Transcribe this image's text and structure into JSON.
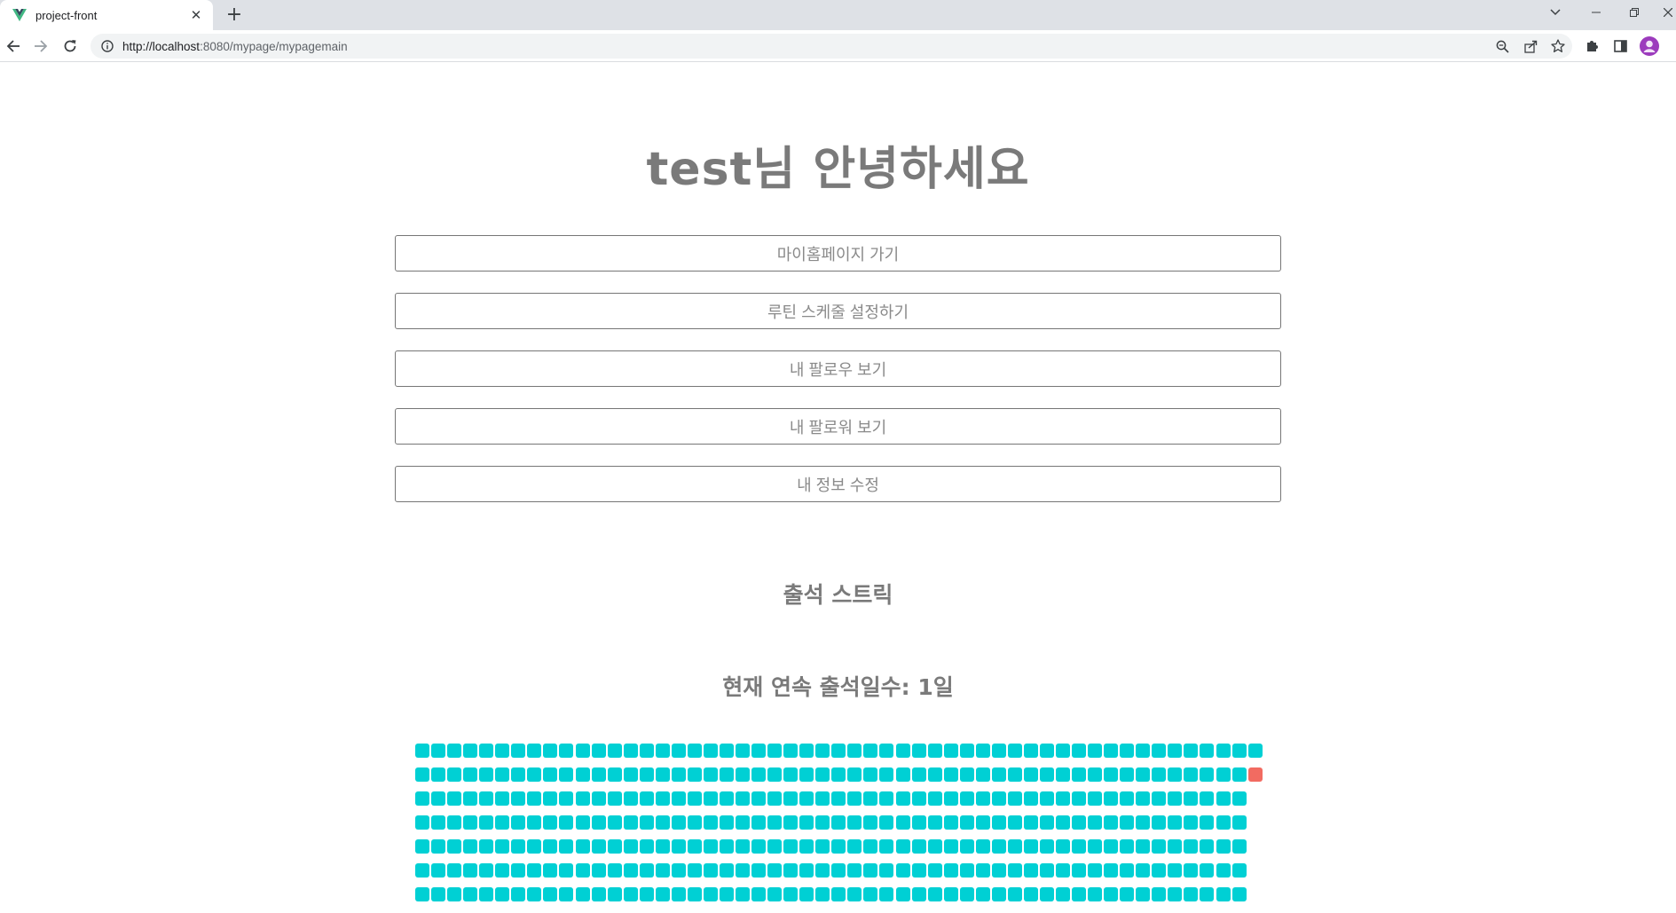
{
  "browser": {
    "tab_title": "project-front",
    "url_host": "http://localhost",
    "url_rest": ":8080/mypage/mypagemain"
  },
  "page": {
    "greeting": "test님 안녕하세요",
    "buttons": [
      {
        "label": "마이홈페이지 가기"
      },
      {
        "label": "루틴 스케줄 설정하기"
      },
      {
        "label": "내 팔로우 보기"
      },
      {
        "label": "내 팔로워 보기"
      },
      {
        "label": "내 정보 수정"
      }
    ],
    "streak_title": "출석 스트릭",
    "streak_days_text": "현재 연속 출석일수: 1일"
  },
  "streak_grid": {
    "visible_rows": [
      {
        "filled": 53,
        "today_highlight": false
      },
      {
        "filled": 52,
        "today_highlight": true
      },
      {
        "filled": 52,
        "today_highlight": false
      },
      {
        "filled": 52,
        "today_highlight": false
      },
      {
        "filled": 52,
        "today_highlight": false
      },
      {
        "filled": 52,
        "today_highlight": false
      },
      {
        "filled": 52,
        "today_highlight": false
      }
    ],
    "colors": {
      "filled": "#00d0d4",
      "today": "#f26b61"
    }
  }
}
